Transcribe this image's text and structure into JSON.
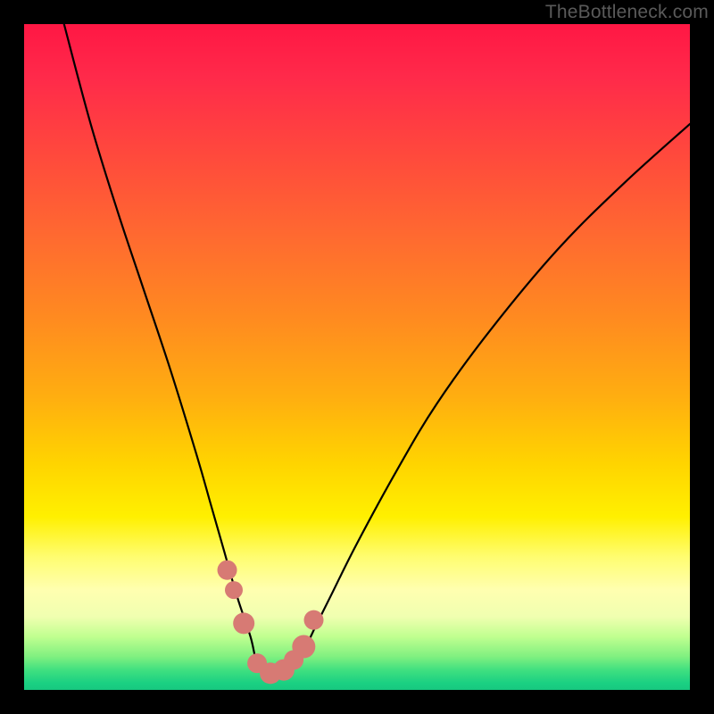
{
  "watermark": "TheBottleneck.com",
  "colors": {
    "frame": "#000000",
    "curve_stroke": "#000000",
    "marker_fill": "#d77a74",
    "gradient_top": "#ff1744",
    "gradient_bottom": "#18c880"
  },
  "chart_data": {
    "type": "line",
    "title": "",
    "xlabel": "",
    "ylabel": "",
    "xlim": [
      0,
      100
    ],
    "ylim": [
      0,
      100
    ],
    "series": [
      {
        "name": "bottleneck-curve",
        "x": [
          6,
          10,
          14,
          18,
          22,
          26,
          28,
          30,
          32,
          34,
          35,
          36.5,
          38,
          40,
          42,
          44,
          46,
          50,
          56,
          62,
          70,
          80,
          90,
          100
        ],
        "values": [
          100,
          85,
          72,
          60,
          48,
          35,
          28,
          21,
          14,
          8,
          4,
          2.5,
          2.5,
          3.5,
          6,
          10,
          14,
          22,
          33,
          43,
          54,
          66,
          76,
          85
        ]
      }
    ],
    "markers": {
      "name": "highlighted-points",
      "x": [
        30.5,
        31.5,
        33.0,
        35.0,
        37.0,
        39.0,
        40.5,
        42.0,
        43.5
      ],
      "values": [
        18.0,
        15.0,
        10.0,
        4.0,
        2.5,
        3.0,
        4.5,
        6.5,
        10.5
      ],
      "size": [
        11,
        10,
        12,
        11,
        12,
        12,
        11,
        13,
        11
      ]
    }
  }
}
